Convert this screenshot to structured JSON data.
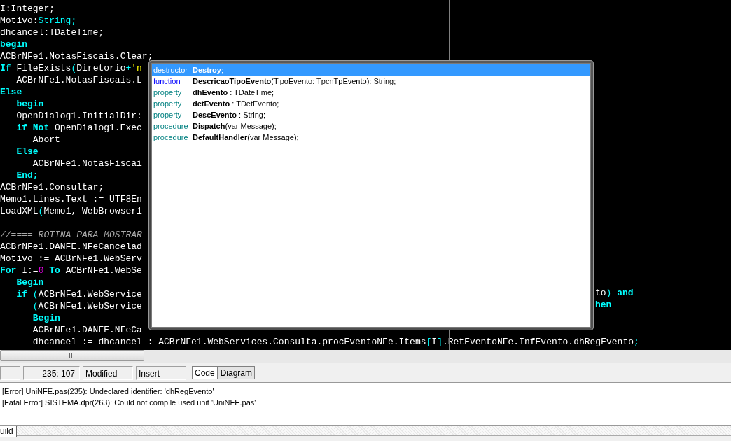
{
  "editor": {
    "lines": [
      {
        "tokens": [
          {
            "text": "I:Integer;",
            "kind": "text"
          }
        ]
      },
      {
        "tokens": [
          {
            "text": "Motivo:",
            "kind": "text"
          },
          {
            "text": "String",
            "kind": "type"
          },
          {
            "text": ";",
            "kind": "symbol"
          }
        ]
      },
      {
        "tokens": [
          {
            "text": "dhcancel:TDateTime;",
            "kind": "text"
          }
        ]
      },
      {
        "tokens": [
          {
            "text": "begin",
            "kind": "keyword"
          }
        ]
      },
      {
        "tokens": [
          {
            "text": "ACBrNFe1.NotasFiscais.Clear;",
            "kind": "text"
          }
        ]
      },
      {
        "tokens": [
          {
            "text": "If",
            "kind": "keyword"
          },
          {
            "text": " FileExists",
            "kind": "text"
          },
          {
            "text": "(",
            "kind": "symbol"
          },
          {
            "text": "Diretorio",
            "kind": "text"
          },
          {
            "text": "+",
            "kind": "symbol"
          },
          {
            "text": "'n",
            "kind": "string"
          }
        ]
      },
      {
        "tokens": [
          {
            "text": "   ACBrNFe1.NotasFiscais.L",
            "kind": "text"
          }
        ]
      },
      {
        "tokens": [
          {
            "text": "Else",
            "kind": "keyword"
          }
        ]
      },
      {
        "tokens": [
          {
            "text": "   begin",
            "kind": "keyword"
          }
        ]
      },
      {
        "tokens": [
          {
            "text": "   OpenDialog1.InitialDir:",
            "kind": "text"
          }
        ]
      },
      {
        "tokens": [
          {
            "text": "   if",
            "kind": "keyword"
          },
          {
            "text": " Not",
            "kind": "keyword"
          },
          {
            "text": " OpenDialog1.Exec",
            "kind": "text"
          }
        ]
      },
      {
        "tokens": [
          {
            "text": "      Abort",
            "kind": "text"
          }
        ]
      },
      {
        "tokens": [
          {
            "text": "   Else",
            "kind": "keyword"
          }
        ]
      },
      {
        "tokens": [
          {
            "text": "      ACBrNFe1.NotasFiscai",
            "kind": "text"
          }
        ]
      },
      {
        "tokens": [
          {
            "text": "   End;",
            "kind": "keyword"
          }
        ]
      },
      {
        "tokens": [
          {
            "text": "ACBrNFe1.Consultar;",
            "kind": "text"
          }
        ]
      },
      {
        "tokens": [
          {
            "text": "Memo1.Lines.Text := UTF8En",
            "kind": "text"
          }
        ]
      },
      {
        "tokens": [
          {
            "text": "LoadXML",
            "kind": "text"
          },
          {
            "text": "(",
            "kind": "symbol"
          },
          {
            "text": "Memo1, WebBrowser1",
            "kind": "text"
          }
        ]
      },
      {
        "kind": "blank"
      },
      {
        "tokens": [
          {
            "text": "//==== ROTINA PARA MOSTRAR",
            "kind": "comment"
          }
        ]
      },
      {
        "tokens": [
          {
            "text": "ACBrNFe1.DANFE.NFeCancelad",
            "kind": "text"
          }
        ]
      },
      {
        "tokens": [
          {
            "text": "Motivo := ACBrNFe1.WebServ",
            "kind": "text"
          }
        ]
      },
      {
        "tokens": [
          {
            "text": "For",
            "kind": "keyword"
          },
          {
            "text": " I:=",
            "kind": "text"
          },
          {
            "text": "0",
            "kind": "number"
          },
          {
            "text": " To",
            "kind": "keyword"
          },
          {
            "text": " ACBrNFe1.WebSe",
            "kind": "text"
          }
        ]
      },
      {
        "tokens": [
          {
            "text": "   Begin",
            "kind": "keyword"
          }
        ]
      },
      {
        "tokens": [
          {
            "text": "   if",
            "kind": "keyword"
          },
          {
            "text": " (",
            "kind": "symbol"
          },
          {
            "text": "ACBrNFe1.WebService",
            "kind": "text"
          }
        ],
        "tail": [
          {
            "text": "to",
            "kind": "text"
          },
          {
            "text": ")",
            "kind": "symbol"
          },
          {
            "text": " and",
            "kind": "keyword"
          }
        ]
      },
      {
        "tokens": [
          {
            "text": "      (",
            "kind": "symbol"
          },
          {
            "text": "ACBrNFe1.WebService",
            "kind": "text"
          }
        ],
        "tail": [
          {
            "text": "hen",
            "kind": "keyword"
          }
        ]
      },
      {
        "tokens": [
          {
            "text": "      Begin",
            "kind": "keyword"
          }
        ]
      },
      {
        "tokens": [
          {
            "text": "      ACBrNFe1.DANFE.NFeCa",
            "kind": "text"
          }
        ]
      },
      {
        "tokens": [
          {
            "text": "      dhcancel := dhcancel : ACBrNFe1.WebServices.Consulta.procEventoNFe.Items",
            "kind": "text"
          },
          {
            "text": "[",
            "kind": "symbol"
          },
          {
            "text": "I",
            "kind": "text"
          },
          {
            "text": "]",
            "kind": "symbol"
          },
          {
            "text": ".RetEventoNFe.InfEvento.dhRegEvento",
            "kind": "text"
          },
          {
            "text": ";",
            "kind": "symbol"
          }
        ]
      }
    ]
  },
  "completion": {
    "items": [
      {
        "type": "destructor",
        "signature": "**Destroy**;",
        "selected": true
      },
      {
        "type": "function",
        "color": "#0000ff",
        "signature": "**DescricaoTipoEvento**(TipoEvento: TpcnTpEvento): String;",
        "selected": false
      },
      {
        "type": "property",
        "color": "#008080",
        "signature": "**dhEvento** : TDateTime;",
        "selected": false
      },
      {
        "type": "property",
        "color": "#008080",
        "signature": "**detEvento** : TDetEvento;",
        "selected": false
      },
      {
        "type": "property",
        "color": "#008080",
        "signature": "**DescEvento** : String;",
        "selected": false
      },
      {
        "type": "procedure",
        "color": "#008080",
        "signature": "**Dispatch**(var Message);",
        "selected": false
      },
      {
        "type": "procedure",
        "color": "#008080",
        "signature": "**DefaultHandler**(var Message);",
        "selected": false
      }
    ]
  },
  "status_bar": {
    "position": "235: 107",
    "modified": "Modified",
    "mode": "Insert",
    "tabs": [
      {
        "label": "Code",
        "selected": true
      },
      {
        "label": "Diagram",
        "selected": false
      }
    ]
  },
  "messages": [
    "[Error] UniNFE.pas(235): Undeclared identifier: 'dhRegEvento'",
    "[Fatal Error] SISTEMA.dpr(263): Could not compile used unit 'UniNFE.pas'"
  ],
  "bottom_tabs": [
    {
      "label": "uild"
    }
  ]
}
